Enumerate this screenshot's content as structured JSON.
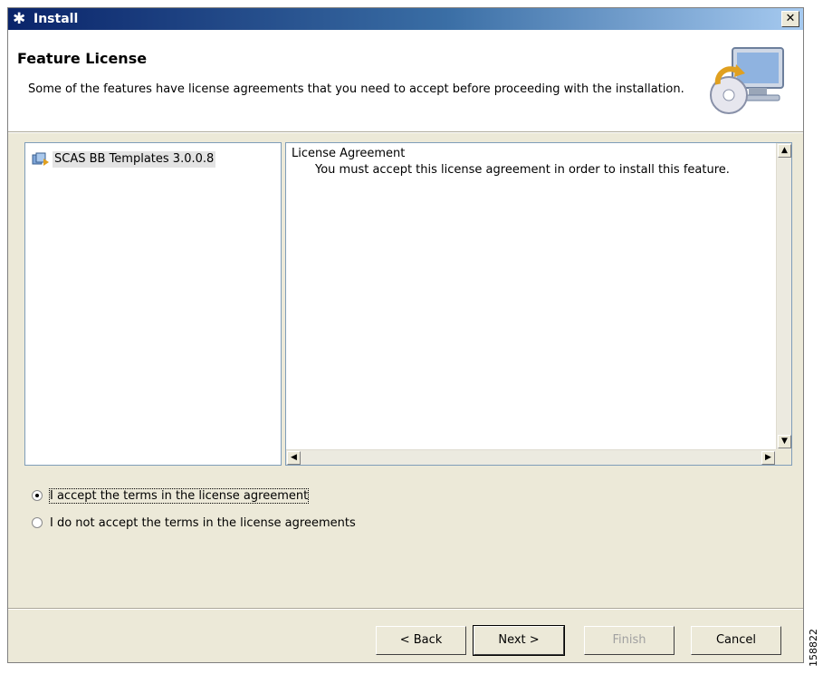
{
  "window": {
    "title": "Install"
  },
  "header": {
    "title": "Feature License",
    "description": "Some of the features have license agreements that you need to accept before proceeding with the installation."
  },
  "features": [
    {
      "label": "SCAS BB Templates 3.0.0.8"
    }
  ],
  "license": {
    "heading": "License Agreement",
    "text": "You must accept this license agreement in order to install this feature."
  },
  "options": {
    "accept": {
      "label": "I accept the terms in the license agreement",
      "selected": true
    },
    "decline": {
      "label": "I do not accept the terms in the license agreements",
      "selected": false
    }
  },
  "buttons": {
    "back": "< Back",
    "next": "Next >",
    "finish": "Finish",
    "cancel": "Cancel"
  },
  "side_code": "158822",
  "colors": {
    "titlebar_start": "#0a246a",
    "titlebar_end": "#a6caf0",
    "dialog_bg": "#ece9d8"
  }
}
